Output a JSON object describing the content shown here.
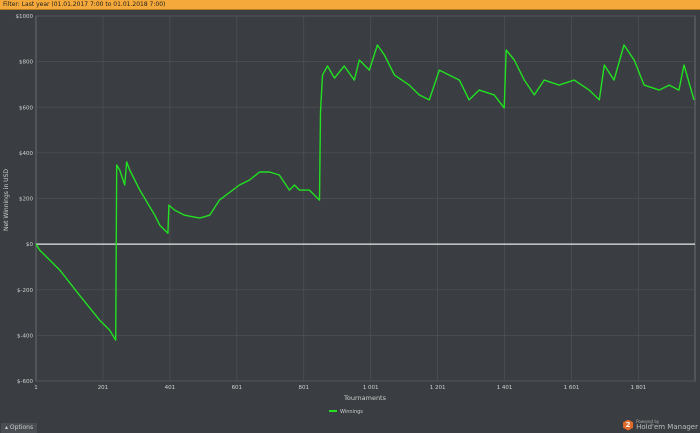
{
  "filter": {
    "text": "Filter: Last year (01.01.2017 7:00 to 01.01.2018 7:00)"
  },
  "options_label": "Options",
  "brand": {
    "powered": "Powered by",
    "name": "Hold'em Manager",
    "logo": "2"
  },
  "chart_data": {
    "type": "line",
    "title": "",
    "xlabel": "Tournaments",
    "ylabel": "Net Winnings in USD",
    "xlim": [
      1,
      1970
    ],
    "ylim": [
      -600,
      1000
    ],
    "xticks": [
      1,
      201,
      401,
      601,
      801,
      1001,
      1201,
      1401,
      1601,
      1801
    ],
    "xtick_labels": [
      "1",
      "201",
      "401",
      "601",
      "801",
      "1 001",
      "1 201",
      "1 401",
      "1 601",
      "1 801"
    ],
    "yticks": [
      1000,
      800,
      600,
      400,
      200,
      0,
      -200,
      -400,
      -600
    ],
    "ytick_labels": [
      "$1000",
      "$800",
      "$600",
      "$400",
      "$200",
      "$0",
      "$-200",
      "$-400",
      "$-600"
    ],
    "grid": true,
    "legend": "bottom-center",
    "series": [
      {
        "name": "Winnings",
        "color": "#22e022",
        "x": [
          1,
          12,
          72,
          131,
          191,
          221,
          239,
          242,
          251,
          266,
          272,
          281,
          311,
          356,
          371,
          395,
          398,
          415,
          445,
          490,
          520,
          549,
          609,
          639,
          669,
          699,
          728,
          758,
          773,
          788,
          818,
          848,
          851,
          857,
          872,
          893,
          922,
          952,
          967,
          997,
          1021,
          1042,
          1072,
          1116,
          1146,
          1176,
          1206,
          1236,
          1266,
          1295,
          1325,
          1370,
          1400,
          1406,
          1430,
          1460,
          1490,
          1519,
          1564,
          1609,
          1654,
          1684,
          1699,
          1728,
          1758,
          1788,
          1818,
          1863,
          1893,
          1922,
          1937,
          1967
        ],
        "y": [
          0,
          -26,
          -114,
          -224,
          -333,
          -377,
          -421,
          347,
          325,
          259,
          360,
          325,
          237,
          127,
          83,
          48,
          171,
          149,
          127,
          114,
          127,
          193,
          259,
          281,
          316,
          316,
          303,
          237,
          259,
          237,
          237,
          193,
          579,
          741,
          781,
          728,
          781,
          719,
          807,
          763,
          873,
          829,
          741,
          697,
          654,
          632,
          763,
          741,
          719,
          632,
          675,
          654,
          597,
          851,
          807,
          719,
          654,
          719,
          697,
          719,
          675,
          632,
          785,
          719,
          873,
          807,
          697,
          675,
          697,
          675,
          785,
          632
        ]
      }
    ]
  }
}
